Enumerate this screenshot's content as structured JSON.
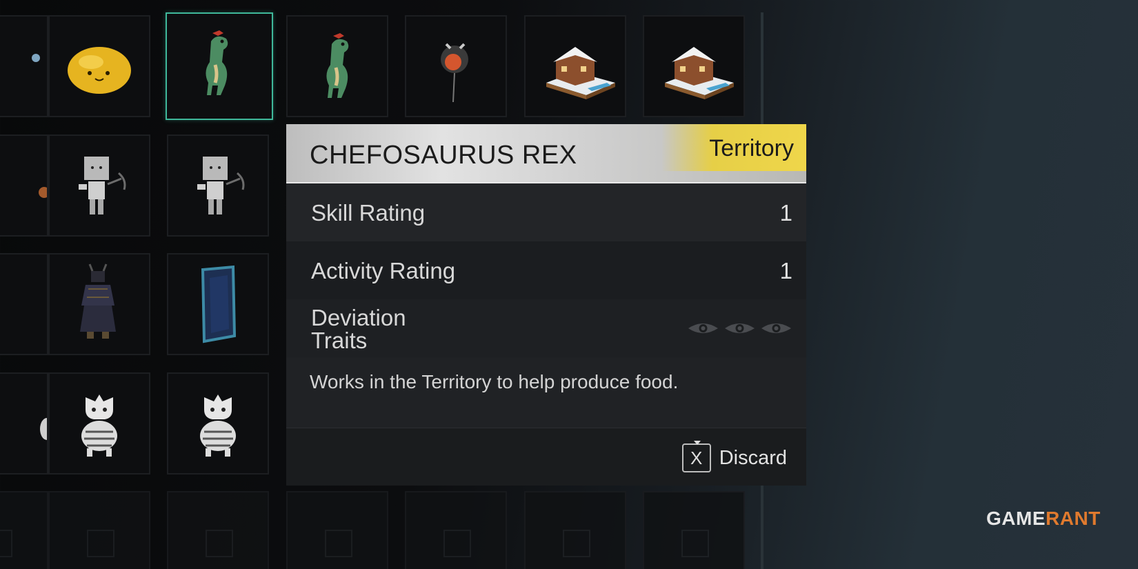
{
  "tooltip": {
    "title": "CHEFOSAURUS REX",
    "category_badge": "Territory",
    "stats": [
      {
        "label": "Skill Rating",
        "value": "1"
      },
      {
        "label": "Activity Rating",
        "value": "1"
      }
    ],
    "traits_label": "Deviation Traits",
    "traits_icons": [
      "eye-icon",
      "eye-icon",
      "eye-icon"
    ],
    "description": "Works in the Territory to help produce food.",
    "action": {
      "key": "X",
      "label": "Discard"
    }
  },
  "inventory": {
    "selected_item": "Chefosaurus Rex",
    "slots": [
      {
        "icon": "partial-blue-item-icon"
      },
      {
        "icon": "yellow-blob-deviation-icon"
      },
      {
        "icon": "green-dinosaur-deviation-icon"
      },
      {
        "icon": "green-dinosaur-deviation-icon"
      },
      {
        "icon": "floating-orb-deviation-icon"
      },
      {
        "icon": "gingerbread-house-icon"
      },
      {
        "icon": "gingerbread-house-icon"
      },
      {
        "icon": "partial-orange-item-icon"
      },
      {
        "icon": "cube-robot-miner-icon"
      },
      {
        "icon": "cube-robot-miner-icon"
      },
      {
        "icon": "samurai-armor-icon"
      },
      {
        "icon": "blue-portal-frame-icon"
      },
      {
        "icon": "partial-cat-icon"
      },
      {
        "icon": "striped-cat-deviation-icon"
      },
      {
        "icon": "striped-cat-deviation-icon"
      }
    ]
  },
  "watermark": {
    "part1": "GAME",
    "part2": "RANT"
  },
  "colors": {
    "selection_border": "#3fb89a",
    "badge_yellow": "#efd64a",
    "watermark_accent": "#e07a2e"
  }
}
